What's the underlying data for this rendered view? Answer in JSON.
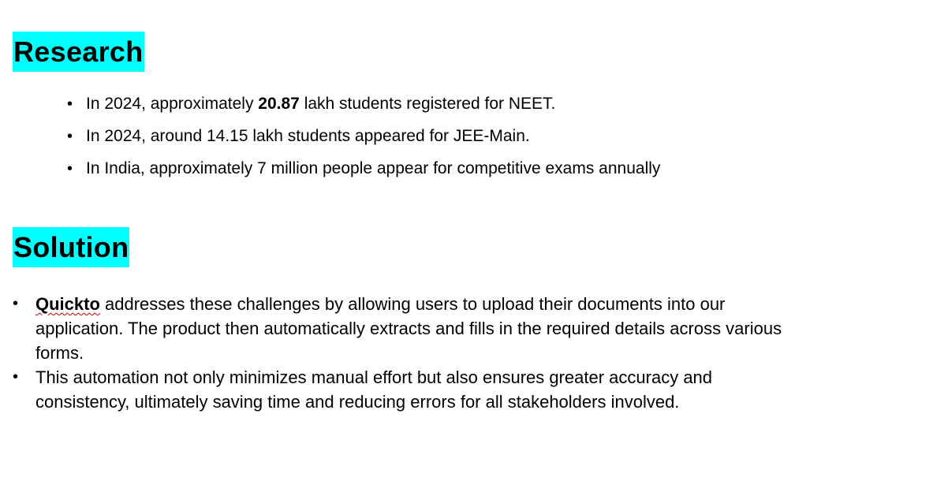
{
  "research": {
    "heading": "Research",
    "items": [
      {
        "pre": "In 2024, approximately ",
        "bold": "20.87",
        "post": " lakh students registered for NEET."
      },
      {
        "text": "In 2024, around 14.15 lakh students appeared for JEE-Main."
      },
      {
        "text": "In India, approximately 7 million people appear for competitive exams annually"
      }
    ]
  },
  "solution": {
    "heading": "Solution",
    "items": [
      {
        "bold": "Quickto",
        "post": " addresses these challenges by allowing users to upload their documents into our application. The product then automatically extracts and fills in the required details across various forms."
      },
      {
        "text": "This automation not only minimizes manual effort but also ensures greater accuracy and consistency, ultimately saving time and reducing errors for all stakeholders involved."
      }
    ]
  },
  "bullet_char": "•",
  "colors": {
    "heading_highlight": "#00ffff",
    "spellcheck_underline": "#c00000"
  }
}
